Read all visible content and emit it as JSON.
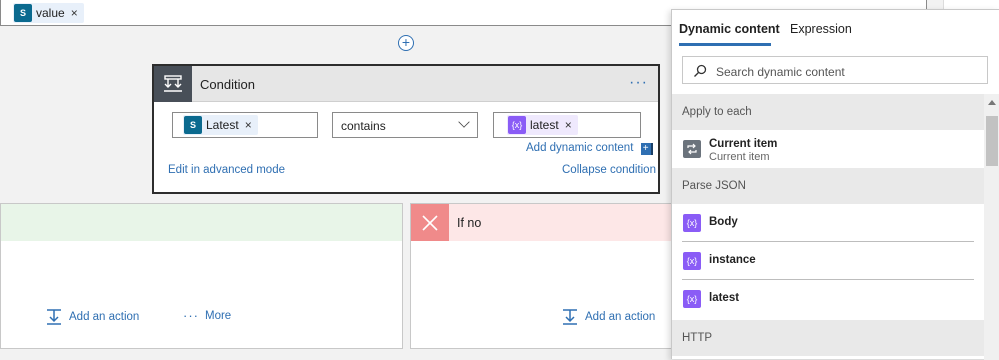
{
  "top_field": {
    "token_label": "value",
    "token_remove": "×"
  },
  "plus_label": "+",
  "condition": {
    "title": "Condition",
    "menu": "···",
    "left_token": {
      "label": "Latest",
      "remove": "×"
    },
    "operator": "contains",
    "right_token": {
      "label": "latest",
      "remove": "×"
    },
    "add_dynamic": "Add dynamic content",
    "add_dynamic_badge": "+",
    "edit_advanced": "Edit in advanced mode",
    "collapse": "Collapse condition"
  },
  "branch_yes": {
    "add_action": "Add an action",
    "more": "More",
    "more_dots": "···"
  },
  "branch_no": {
    "title": "If no",
    "add_action": "Add an action"
  },
  "dynamic_panel": {
    "tabs": [
      "Dynamic content",
      "Expression"
    ],
    "search_placeholder": "Search dynamic content",
    "groups": [
      {
        "name": "Apply to each",
        "items": [
          {
            "name": "Current item",
            "sub": "Current item",
            "icon": "loop-icon"
          }
        ]
      },
      {
        "name": "Parse JSON",
        "items": [
          {
            "name": "Body",
            "icon": "expression-icon"
          },
          {
            "name": "instance",
            "icon": "expression-icon"
          },
          {
            "name": "latest",
            "icon": "expression-icon"
          }
        ]
      },
      {
        "name": "HTTP",
        "items": []
      }
    ]
  },
  "icon_glyphs": {
    "sharepoint": "S",
    "expression": "{x}"
  },
  "colors": {
    "accent": "#2f6fb2",
    "sharepoint": "#0b6a8f",
    "expression": "#8a5cf6",
    "condition_header": "#484f58",
    "if_no": "#f08a8a",
    "if_yes_bg": "#e8f5e8",
    "if_no_bg": "#fde7e7"
  }
}
